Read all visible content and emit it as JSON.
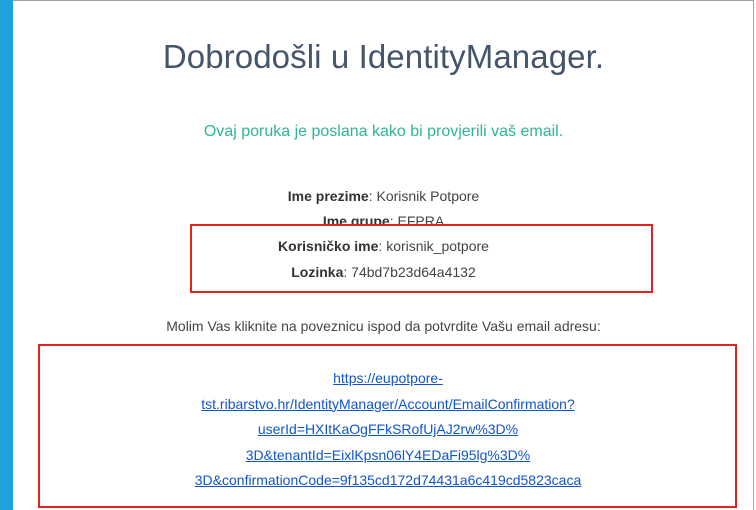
{
  "email": {
    "title": "Dobrodošli u IdentityManager.",
    "subtitle": "Ovaj poruka je poslana kako bi provjerili vaš email.",
    "fields": [
      {
        "label": "Ime prezime",
        "separator": ": ",
        "value": "Korisnik Potpore"
      },
      {
        "label": "Ime grupe",
        "separator": ": ",
        "value": "EFPRA"
      },
      {
        "label": "Korisničko ime",
        "separator": ": ",
        "value": "korisnik_potpore"
      },
      {
        "label": "Lozinka",
        "separator": ": ",
        "value": "74bd7b23d64a4132"
      }
    ],
    "instruction": "Molim Vas kliknite na poveznicu ispod da potvrdite Vašu email adresu:",
    "link_lines": [
      "https://eupotpore-",
      "tst.ribarstvo.hr/IdentityManager/Account/EmailConfirmation?",
      "userId=HXItKaOgFFkSRofUjAJ2rw%3D%",
      "3D&tenantId=EixlKpsn06lY4EDaFi95lg%3D%",
      "3D&confirmationCode=9f135cd172d74431a6c419cd5823caca"
    ]
  },
  "colors": {
    "left_bar": "#1ea1dc",
    "title": "#44546a",
    "subtitle": "#2fb39a",
    "highlight_box": "#e32222",
    "link": "#1155cc"
  }
}
